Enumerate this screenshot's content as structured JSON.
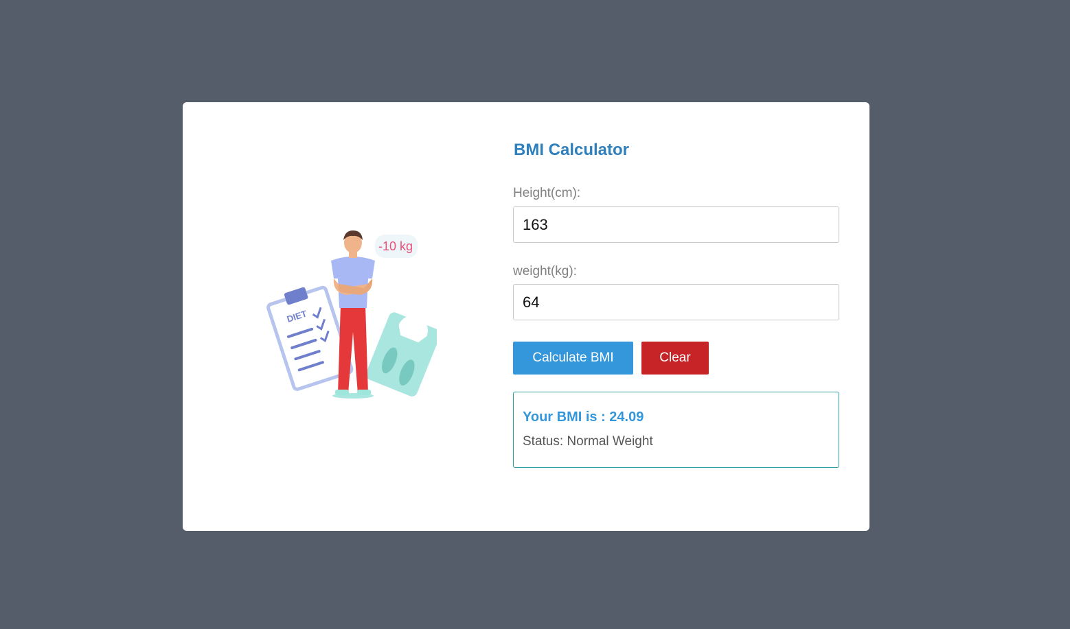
{
  "app": {
    "title": "BMI Calculator"
  },
  "illustration": {
    "badge_text": "-10 kg",
    "clipboard_text": "DIET"
  },
  "form": {
    "height_label": "Height(cm):",
    "height_value": "163",
    "weight_label": "weight(kg):",
    "weight_value": "64",
    "calculate_label": "Calculate BMI",
    "clear_label": "Clear"
  },
  "result": {
    "bmi_text": "Your BMI is : 24.09",
    "status_text": "Status: Normal Weight"
  },
  "colors": {
    "background": "#565d6a",
    "card": "#ffffff",
    "accent_blue": "#3597db",
    "title_blue": "#2e7fbd",
    "clear_red": "#c62427",
    "result_border": "#2a9d9f"
  },
  "icons": {
    "illustration": "person-weight-loss-illustration"
  }
}
